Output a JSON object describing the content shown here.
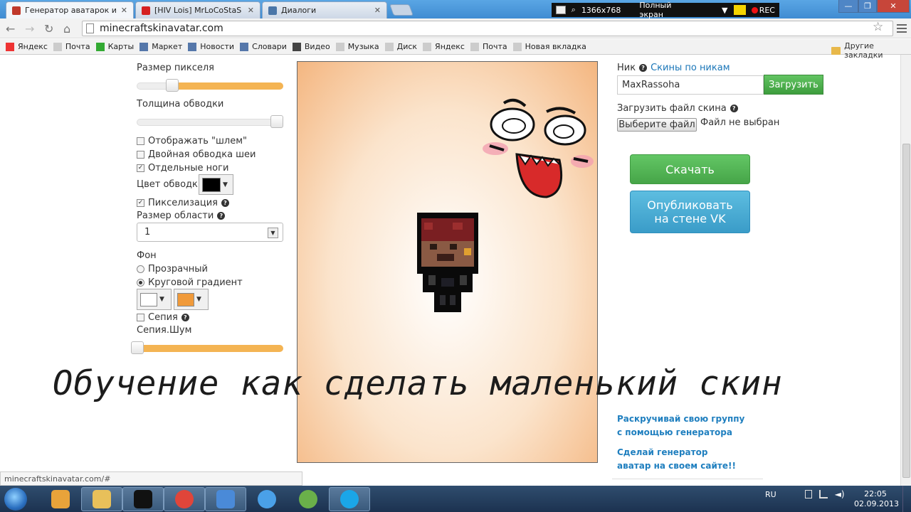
{
  "tabs": [
    {
      "label": "Генератор аватарок и ар",
      "close": "✕",
      "icon": "minecraft-icon",
      "color": "#c0392b"
    },
    {
      "label": "[HIV Lois] MrLoCoStaS - Y",
      "close": "✕",
      "icon": "youtube-icon",
      "color": "#d62020"
    },
    {
      "label": "Диалоги",
      "close": "✕",
      "icon": "vk-icon",
      "color": "#4a76a8"
    }
  ],
  "recorder": {
    "resolution": "1366x768",
    "mode": "Полный экран",
    "rec": "REC"
  },
  "window_controls": {
    "minimize": "—",
    "maximize": "❐",
    "close": "✕"
  },
  "address": {
    "url": "minecraftskinavatar.com",
    "back": "←",
    "forward": "→",
    "reload": "↻",
    "home": "⌂",
    "star": "☆"
  },
  "bookmarks": [
    {
      "label": "Яндекс",
      "icon": "yandex-icon",
      "color": "#e33"
    },
    {
      "label": "Почта",
      "icon": "page-icon",
      "color": "#ccc"
    },
    {
      "label": "Карты",
      "icon": "maps-icon",
      "color": "#3a3"
    },
    {
      "label": "Маркет",
      "icon": "market-icon",
      "color": "#57a"
    },
    {
      "label": "Новости",
      "icon": "news-icon",
      "color": "#57a"
    },
    {
      "label": "Словари",
      "icon": "dict-icon",
      "color": "#57a"
    },
    {
      "label": "Видео",
      "icon": "video-icon",
      "color": "#444"
    },
    {
      "label": "Музыка",
      "icon": "page-icon",
      "color": "#ccc"
    },
    {
      "label": "Диск",
      "icon": "page-icon",
      "color": "#ccc"
    },
    {
      "label": "Яндекс",
      "icon": "page-icon",
      "color": "#ccc"
    },
    {
      "label": "Почта",
      "icon": "page-icon",
      "color": "#ccc"
    },
    {
      "label": "Новая вкладка",
      "icon": "page-icon",
      "color": "#ccc"
    }
  ],
  "other_bookmarks": "Другие закладки",
  "left": {
    "pixel_size": {
      "label": "Размер пикселя",
      "value": 0.22
    },
    "stroke_width": {
      "label": "Толщина обводки",
      "value": 1.0
    },
    "show_helmet": {
      "label": "Отображать \"шлем\"",
      "checked": false
    },
    "double_neck": {
      "label": "Двойная обводка шеи",
      "checked": false
    },
    "separate_legs": {
      "label": "Отдельные ноги",
      "checked": true
    },
    "stroke_color": {
      "label": "Цвет обводки",
      "color": "#000000"
    },
    "pixelization": {
      "label": "Пикселизация",
      "checked": true
    },
    "area_size": {
      "label": "Размер области",
      "value": "1"
    },
    "background": {
      "label": "Фон",
      "transparent": {
        "label": "Прозрачный",
        "selected": false
      },
      "radial": {
        "label": "Круговой градиент",
        "selected": true
      },
      "color1": "#ffffff",
      "color2": "#f09a3a"
    },
    "sepia": {
      "label": "Сепия",
      "checked": false
    },
    "sepia_noise": {
      "label": "Сепия.Шум",
      "value": 0.0
    },
    "check_mark": "✓",
    "arrow": "▼",
    "help": "?"
  },
  "right": {
    "nick_label": "Ник",
    "nick_link": "Скины по никам",
    "nick_value": "MaxRassoha",
    "load_button": "Загрузить",
    "upload_label": "Загрузить файл скина",
    "file_button": "Выберите файл",
    "file_status": "Файл не выбран",
    "download_button": "Скачать",
    "vk_button": "Опубликовать\nна стене VK",
    "promo1_line1": "Раскручивай свою группу",
    "promo1_line2": "с помощью генератора",
    "promo2_line1": "Сделай генератор",
    "promo2_line2": "аватар на своем сайте!!"
  },
  "overlay_caption": "Обучение как сделать маленький скин",
  "status_url": "minecraftskinavatar.com/#",
  "taskbar": {
    "apps": [
      {
        "name": "taskbar-media-player",
        "color": "#e8a33a",
        "active": false
      },
      {
        "name": "taskbar-explorer",
        "color": "#e8c05a",
        "active": true
      },
      {
        "name": "taskbar-unknown-app",
        "color": "#111",
        "active": true
      },
      {
        "name": "taskbar-chrome",
        "color": "#e0453a",
        "active": true
      },
      {
        "name": "taskbar-audio",
        "color": "#4a8ad8",
        "active": true
      },
      {
        "name": "taskbar-network",
        "color": "#4aa0e8",
        "active": false
      },
      {
        "name": "taskbar-game",
        "color": "#6ab04a",
        "active": false
      },
      {
        "name": "taskbar-skype",
        "color": "#1aa6e8",
        "active": true
      }
    ],
    "lang": "RU",
    "time": "22:05",
    "date": "02.09.2013"
  }
}
